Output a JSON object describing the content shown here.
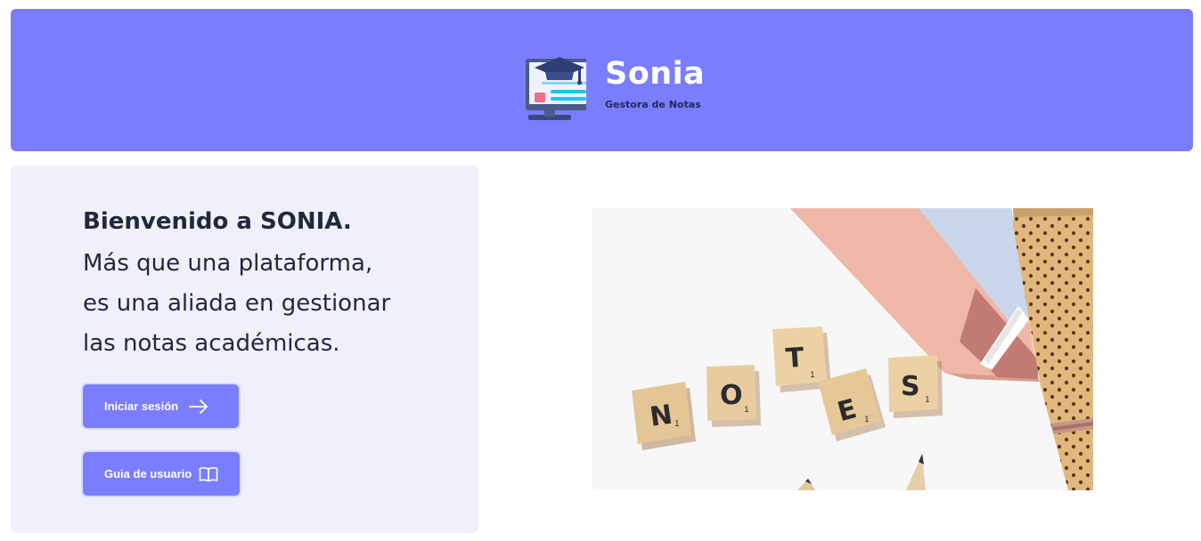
{
  "header": {
    "logo_title": "Sonia",
    "logo_subtitle": "Gestora de Notas",
    "background_color": "#7b7dff"
  },
  "welcome": {
    "heading": "Bienvenido a SONIA.",
    "lines": [
      "Más que una plataforma,",
      "es una aliada en gestionar",
      "las notas académicas."
    ]
  },
  "buttons": {
    "login_label": "Iniciar sesión",
    "login_icon": "arrow-right-icon",
    "guide_label": "Guia de usuario",
    "guide_icon": "book-open-icon",
    "color": "#7b7dff"
  },
  "photo": {
    "tiles": [
      "N",
      "O",
      "T",
      "E",
      "S"
    ],
    "tile_subscripts": [
      "1",
      "1",
      "1",
      "1",
      "1"
    ]
  }
}
